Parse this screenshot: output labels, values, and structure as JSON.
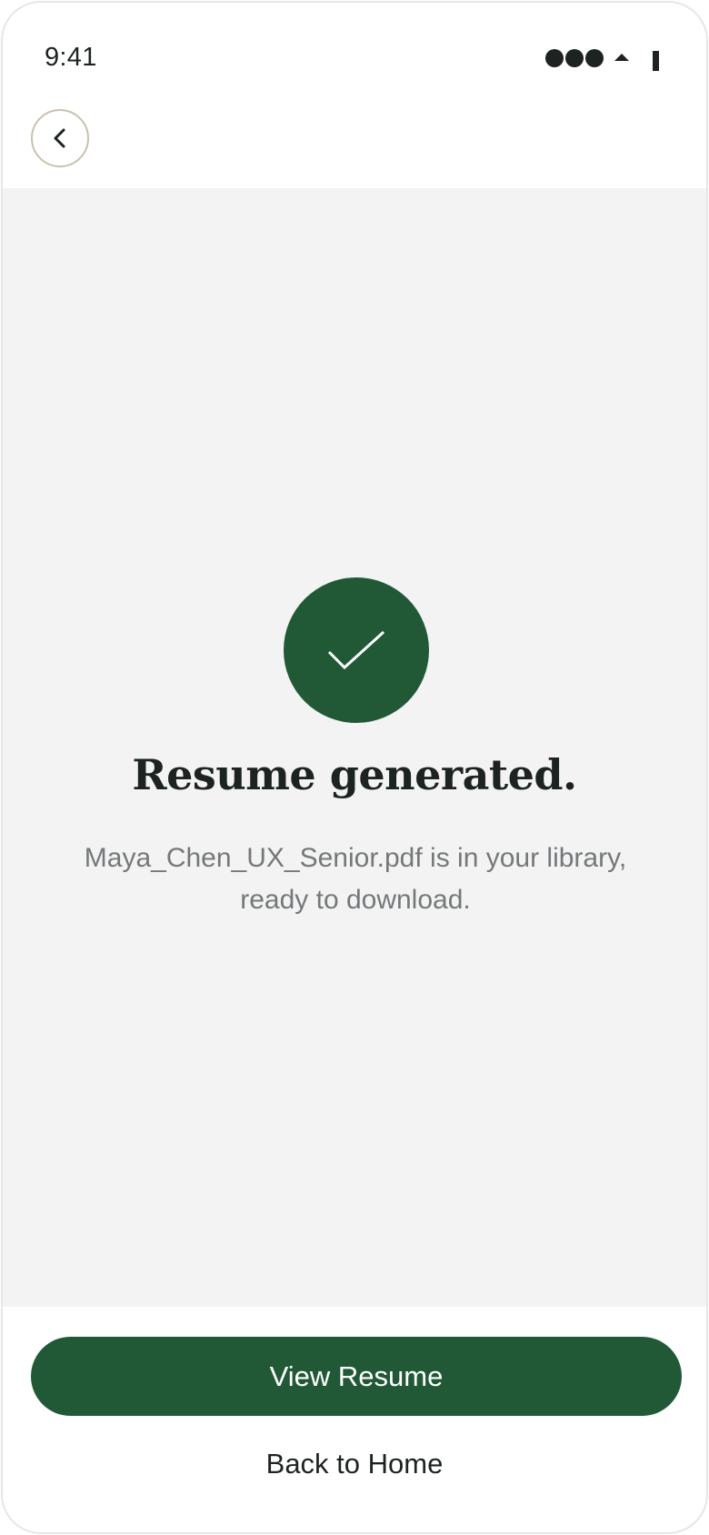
{
  "status_bar": {
    "time": "9:41"
  },
  "header": {
    "back_icon": "chevron-left-icon"
  },
  "success": {
    "icon": "check-icon",
    "title": "Resume generated.",
    "message": "Maya_Chen_UX_Senior.pdf is in your library, ready to download."
  },
  "actions": {
    "primary_label": "View Resume",
    "secondary_label": "Back to Home"
  },
  "colors": {
    "accent": "#215937",
    "background": "#f3f3f3",
    "text": "#1d2320",
    "muted": "#75787a",
    "border": "#c8c2ae"
  }
}
